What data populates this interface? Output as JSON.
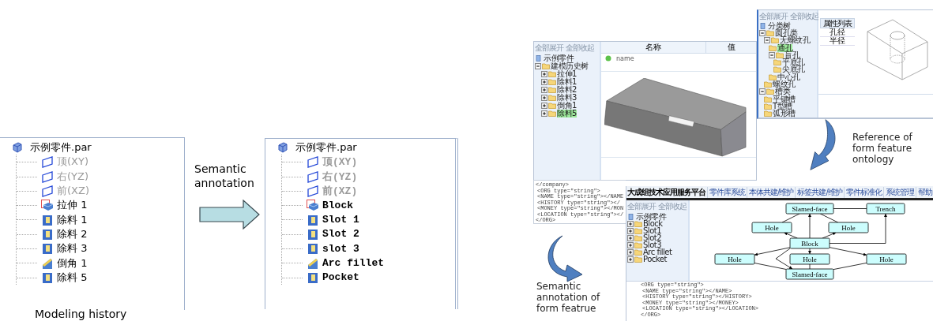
{
  "history_panel": {
    "root": {
      "label": "示例零件.par"
    },
    "items": [
      {
        "label": "顶(XY)",
        "kind": "plane",
        "dimmed": true
      },
      {
        "label": "右(YZ)",
        "kind": "plane",
        "dimmed": true
      },
      {
        "label": "前(XZ)",
        "kind": "plane",
        "dimmed": true
      },
      {
        "label": "拉伸 1",
        "kind": "protrusion",
        "dimmed": false
      },
      {
        "label": "除料 1",
        "kind": "cutout",
        "dimmed": false
      },
      {
        "label": "除料 2",
        "kind": "cutout",
        "dimmed": false
      },
      {
        "label": "除料 3",
        "kind": "cutout",
        "dimmed": false
      },
      {
        "label": "倒角 1",
        "kind": "round",
        "dimmed": false
      },
      {
        "label": "除料 5",
        "kind": "cutout",
        "dimmed": false
      }
    ],
    "caption": "Modeling history"
  },
  "annotation_step": {
    "label": "Semantic annotation"
  },
  "annotated_panel": {
    "root": {
      "label": "示例零件.par"
    },
    "items": [
      {
        "label": "顶(XY)",
        "kind": "plane",
        "dimmed": true
      },
      {
        "label": "右(YZ)",
        "kind": "plane",
        "dimmed": true
      },
      {
        "label": "前(XZ)",
        "kind": "plane",
        "dimmed": true
      },
      {
        "label": "Block",
        "kind": "protrusion",
        "dimmed": false
      },
      {
        "label": "Slot 1",
        "kind": "cutout",
        "dimmed": false
      },
      {
        "label": "Slot 2",
        "kind": "cutout",
        "dimmed": false
      },
      {
        "label": "slot 3",
        "kind": "cutout",
        "dimmed": false
      },
      {
        "label": "Arc fillet",
        "kind": "round",
        "dimmed": false
      },
      {
        "label": "Pocket",
        "kind": "cutout",
        "dimmed": false
      }
    ]
  },
  "viewer_window": {
    "toolbar": [
      "全部展开",
      "全部收起"
    ],
    "tree": [
      {
        "label": "示例零件",
        "kind": "file",
        "selected": false
      },
      {
        "label": "建模历史树",
        "kind": "folder",
        "selected": false,
        "expanded": true,
        "children": [
          {
            "label": "拉伸1",
            "kind": "folder",
            "selected": false,
            "expanded": false
          },
          {
            "label": "除料1",
            "kind": "folder",
            "selected": false,
            "expanded": false
          },
          {
            "label": "除料2",
            "kind": "folder",
            "selected": false,
            "expanded": false
          },
          {
            "label": "除料3",
            "kind": "folder",
            "selected": false,
            "expanded": false
          },
          {
            "label": "倒角1",
            "kind": "folder",
            "selected": false,
            "expanded": false
          },
          {
            "label": "除料5",
            "kind": "folder",
            "selected": true,
            "expanded": false
          }
        ]
      }
    ],
    "columns": [
      "名称",
      "值"
    ],
    "property": "name"
  },
  "ontology_window": {
    "toolbar": [
      "全部展开",
      "全部收起"
    ],
    "tree": [
      {
        "label": "分类树",
        "kind": "file",
        "selected": false
      },
      {
        "label": "圆孔类",
        "kind": "folder",
        "selected": false,
        "expanded": true,
        "children": [
          {
            "label": "无螺纹孔",
            "kind": "folder",
            "selected": false,
            "expanded": true,
            "children": [
              {
                "label": "通孔",
                "kind": "folder",
                "selected": true
              },
              {
                "label": "盲孔",
                "kind": "folder",
                "selected": false,
                "expanded": true,
                "children": [
                  {
                    "label": "平底孔",
                    "kind": "folder",
                    "selected": false
                  },
                  {
                    "label": "尖底孔",
                    "kind": "folder",
                    "selected": false
                  }
                ]
              },
              {
                "label": "中心孔",
                "kind": "folder",
                "selected": false
              }
            ]
          },
          {
            "label": "螺纹孔",
            "kind": "folder",
            "selected": false
          }
        ]
      },
      {
        "label": "槽类",
        "kind": "folder",
        "selected": false,
        "expanded": true,
        "children": [
          {
            "label": "平键槽",
            "kind": "folder",
            "selected": false
          },
          {
            "label": "T型槽",
            "kind": "folder",
            "selected": false
          },
          {
            "label": "弧形槽",
            "kind": "folder",
            "selected": false
          }
        ]
      }
    ],
    "table": {
      "header": "属性列表",
      "rows": [
        "孔径",
        "半径"
      ]
    }
  },
  "ontology_note": {
    "label": "Reference of form feature ontology"
  },
  "xml_snippet": {
    "lines": [
      "</company>",
      "<ORG type=\"string\">",
      "<NAME type=\"string\"></NAME",
      "<HISTORY type=\"string\"></",
      "<MONEY type=\"string\"></MON",
      "<LOCATION type=\"string\"></",
      "</ORG>"
    ]
  },
  "platform_window": {
    "title": "大成组技术应用服务平台",
    "menu": [
      "零件库系统",
      "本体共建/维护",
      "标签共建/维护",
      "零件标准化",
      "系统管理",
      "帮助"
    ],
    "toolbar": [
      "全部展开",
      "全部收起"
    ],
    "tree": [
      {
        "label": "示例零件",
        "kind": "file",
        "selected": false
      },
      {
        "label": "Block",
        "kind": "folder",
        "selected": false,
        "expanded": false
      },
      {
        "label": "Slot1",
        "kind": "folder",
        "selected": false,
        "expanded": false
      },
      {
        "label": "Slot2",
        "kind": "folder",
        "selected": false,
        "expanded": false
      },
      {
        "label": "Slot3",
        "kind": "folder",
        "selected": false,
        "expanded": false
      },
      {
        "label": "Arc fillet",
        "kind": "folder",
        "selected": false,
        "expanded": false
      },
      {
        "label": "Pocket",
        "kind": "folder",
        "selected": false,
        "expanded": false
      }
    ],
    "graph": {
      "nodes": [
        {
          "label": "Slamed-face"
        },
        {
          "label": "Trench"
        },
        {
          "label": "Hole"
        },
        {
          "label": "Hole"
        },
        {
          "label": "Block"
        },
        {
          "label": "Hole"
        },
        {
          "label": "Hole"
        },
        {
          "label": "Hole"
        },
        {
          "label": "Slamed-face"
        }
      ]
    },
    "xml_lines": [
      "<ORG type=\"string\">",
      "<NAME type=\"string\"></NAME>",
      "<HISTORY type=\"string\"></HISTORY>",
      "<MONEY type=\"string\"></MONEY>",
      "<LOCATION type=\"string\"></LOCATION>",
      "</ORG>"
    ]
  },
  "annotation_note": {
    "label": "Semantic annotation of form featrue"
  }
}
